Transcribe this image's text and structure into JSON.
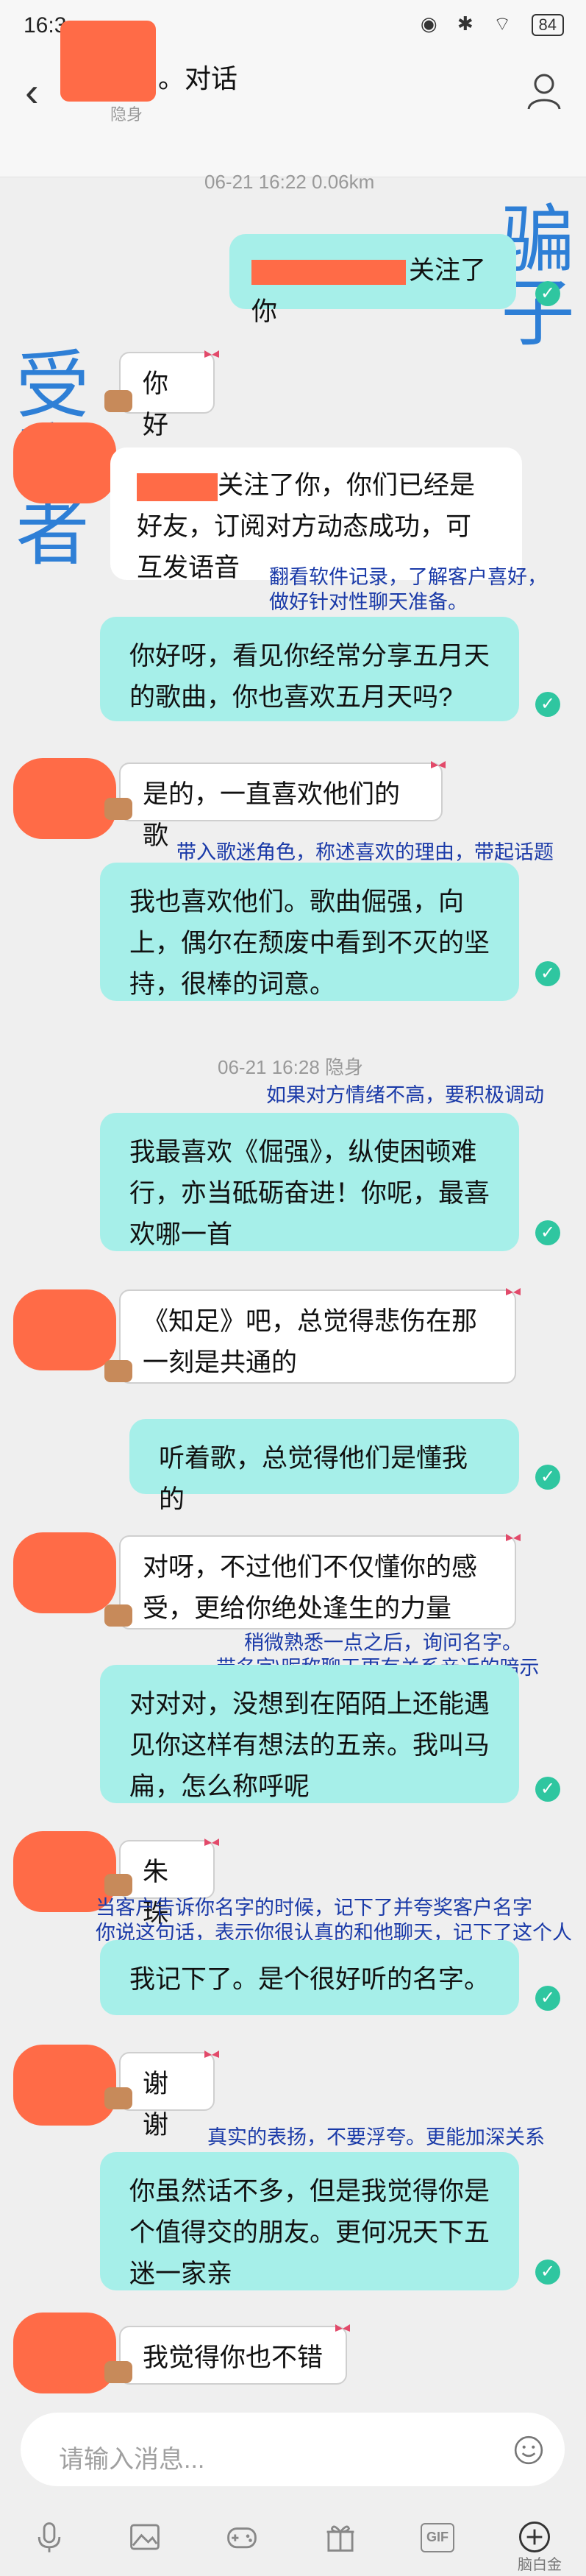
{
  "status_bar": {
    "time": "16:3",
    "icons": "◉ ✱ ⌔ ",
    "battery": "84"
  },
  "header": {
    "title": "。对话",
    "subtitle": "隐身"
  },
  "timestamps": {
    "t1": "06-21 16:22  0.06km",
    "t2": "06-21 16:28  隐身"
  },
  "side_labels": {
    "scammer": "骗子",
    "victim": "受害者"
  },
  "messages": {
    "r1": "关注了你",
    "l1": "你好",
    "sys": "关注了你，你们已经是好友，订阅对方动态成功，可互发语音",
    "r2": "你好呀，看见你经常分享五月天的歌曲，你也喜欢五月天吗?",
    "l2": "是的，一直喜欢他们的歌",
    "r3": "我也喜欢他们。歌曲倔强，向上，偶尔在颓废中看到不灭的坚持，很棒的词意。",
    "r4": "我最喜欢《倔强》，纵使困顿难行，亦当砥砺奋进！你呢，最喜欢哪一首",
    "l3": "《知足》吧，总觉得悲伤在那一刻是共通的",
    "r5": "听着歌，总觉得他们是懂我的",
    "l4": "对呀，不过他们不仅懂你的感受，更给你绝处逢生的力量",
    "r6": "对对对，没想到在陌陌上还能遇见你这样有想法的五亲。我叫马扁，怎么称呼呢",
    "l5": "朱珠",
    "r7": "我记下了。是个很好听的名字。",
    "l6": "谢谢",
    "r8": "你虽然话不多，但是我觉得你是个值得交的朋友。更何况天下五迷一家亲",
    "l7": "我觉得你也不错"
  },
  "notes": {
    "n1": "翻看软件记录，了解客户喜好，",
    "n1b": "做好针对性聊天准备。",
    "n2": "带入歌迷角色，称述喜欢的理由，带起话题",
    "n3": "如果对方情绪不高，要积极调动",
    "n4": "稍微熟悉一点之后，询问名字。",
    "n5": "带名字\\昵称聊天更有关系亲近的暗示",
    "n6": "当客户告诉你名字的时候，记下了并夸奖客户名字",
    "n7": "你说这句话，表示你很认真的和他聊天，记下了这个人",
    "n8": "真实的表扬，不要浮夸。更能加深关系"
  },
  "input": {
    "placeholder": "请输入消息..."
  },
  "toolbar": {
    "gif_label": "GIF",
    "watermark": "脑白金"
  },
  "colors": {
    "bubble_right": "#a6efe9",
    "redaction": "#ff6b47",
    "note_text": "#1a3aa8",
    "side_label": "#2e7fd6",
    "check": "#2fc6a0"
  },
  "icons": [
    "back-icon",
    "user-icon",
    "emoji-icon",
    "mic-icon",
    "image-icon",
    "game-icon",
    "gift-icon",
    "gif-icon",
    "plus-icon",
    "check-icon"
  ]
}
